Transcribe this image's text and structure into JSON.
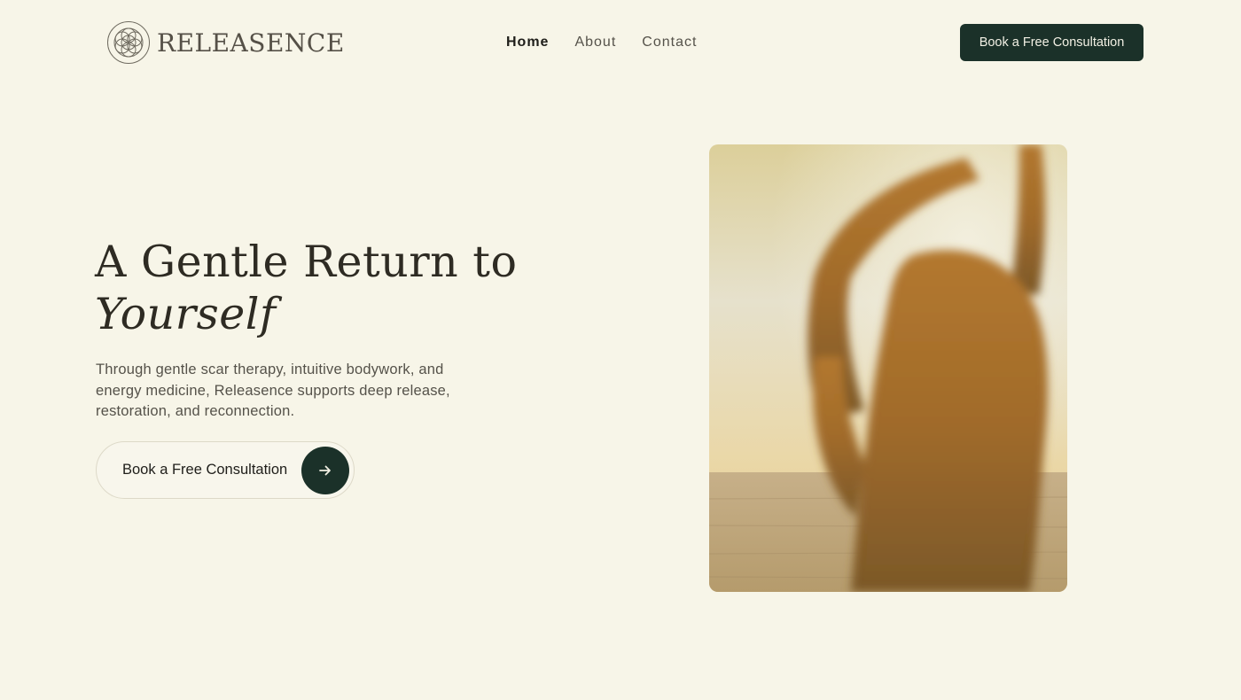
{
  "brand": {
    "name": "RELEASENCE",
    "logo_icon": "flower-of-life-icon"
  },
  "nav": {
    "home": "Home",
    "about": "About",
    "contact": "Contact"
  },
  "header": {
    "cta_label": "Book a Free Consultation"
  },
  "hero": {
    "title_line1": "A Gentle Return to",
    "title_line2": "Yourself",
    "subtitle": "Through gentle scar therapy, intuitive bodywork, and energy medicine, Releasence supports deep release, restoration, and reconnection.",
    "cta_label": "Book a Free Consultation",
    "cta_icon": "arrow-right-icon"
  },
  "colors": {
    "background": "#f7f5e8",
    "accent": "#1b3129",
    "text": "#2e2b23"
  }
}
